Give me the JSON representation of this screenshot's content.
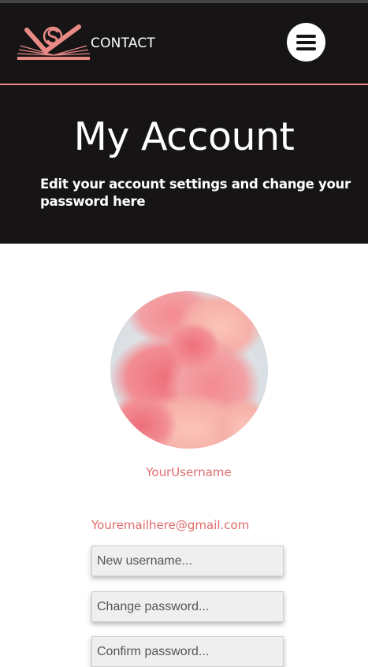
{
  "header": {
    "nav_link": "CONTACT",
    "menu_icon": "hamburger-menu-icon",
    "logo_icon": "sv-book-logo",
    "accent_color": "#e98a86",
    "background_color": "#161415"
  },
  "hero": {
    "title": "My Account",
    "subtitle": "Edit your account settings and change your password here"
  },
  "profile": {
    "avatar": "pink-ink-cloud-avatar",
    "username": "YourUsername",
    "email": "Youremailhere@gmail.com",
    "text_color": "#e06b6b"
  },
  "form": {
    "new_username_placeholder": "New username...",
    "change_password_placeholder": "Change password...",
    "confirm_password_placeholder": "Confirm password..."
  }
}
